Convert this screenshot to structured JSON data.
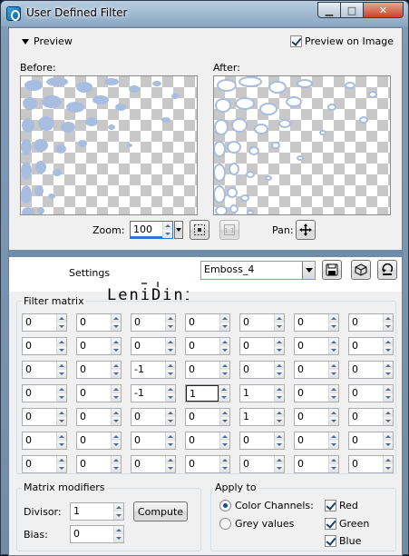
{
  "window": {
    "title": "User Defined Filter"
  },
  "preview": {
    "section_label": "Preview",
    "preview_on_image_label": "Preview on Image",
    "preview_on_image_checked": true,
    "before_label": "Before:",
    "after_label": "After:",
    "zoom_label": "Zoom:",
    "zoom_value": "100",
    "pan_label": "Pan:"
  },
  "settings": {
    "label": "Settings",
    "preset_value": "Emboss_4"
  },
  "logo_text": "LeniDiniz",
  "filter_matrix": {
    "label": "Filter matrix",
    "rows": [
      [
        "0",
        "0",
        "0",
        "0",
        "0",
        "0",
        "0"
      ],
      [
        "0",
        "0",
        "0",
        "0",
        "0",
        "0",
        "0"
      ],
      [
        "0",
        "0",
        "-1",
        "0",
        "0",
        "0",
        "0"
      ],
      [
        "0",
        "0",
        "-1",
        "1",
        "1",
        "0",
        "0"
      ],
      [
        "0",
        "0",
        "0",
        "0",
        "1",
        "0",
        "0"
      ],
      [
        "0",
        "0",
        "0",
        "0",
        "0",
        "0",
        "0"
      ],
      [
        "0",
        "0",
        "0",
        "0",
        "0",
        "0",
        "0"
      ]
    ],
    "focused_cell": [
      3,
      3
    ]
  },
  "modifiers": {
    "label": "Matrix modifiers",
    "divisor_label": "Divisor:",
    "divisor_value": "1",
    "compute_label": "Compute",
    "bias_label": "Bias:",
    "bias_value": "0"
  },
  "apply_to": {
    "label": "Apply to",
    "color_channels_label": "Color Channels:",
    "grey_values_label": "Grey values",
    "mode": "color_channels",
    "red_label": "Red",
    "red_checked": true,
    "green_label": "Green",
    "green_checked": true,
    "blue_label": "Blue",
    "blue_checked": true
  },
  "colors": {
    "accent": "#4c6a9a",
    "preview_blob": "#a9bde0",
    "checker": "#c8c8c8"
  }
}
